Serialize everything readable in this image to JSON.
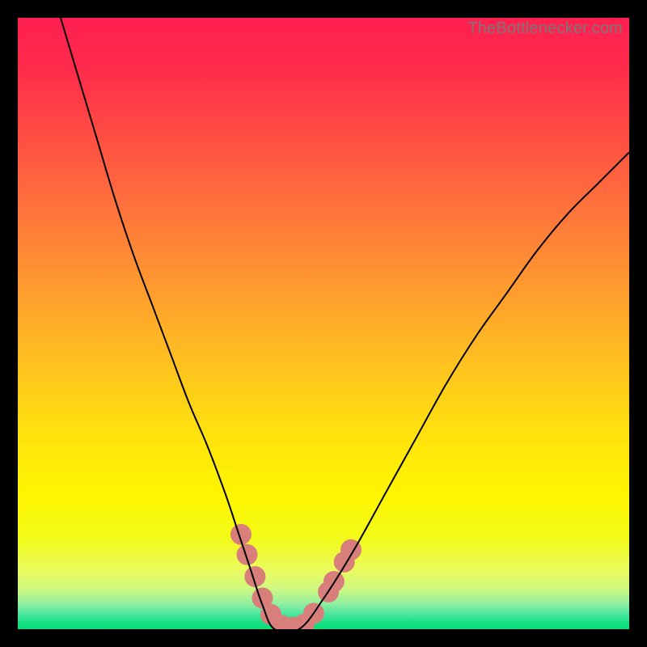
{
  "attribution": "TheBottlenecker.com",
  "chart_data": {
    "type": "line",
    "title": "",
    "xlabel": "",
    "ylabel": "",
    "xlim": [
      0,
      100
    ],
    "ylim": [
      0,
      100
    ],
    "series": [
      {
        "name": "bottleneck-curve",
        "x": [
          7,
          10,
          13,
          16,
          19,
          22,
          25,
          28,
          31,
          34,
          36,
          38,
          40,
          42,
          46,
          50,
          55,
          60,
          65,
          70,
          75,
          80,
          85,
          90,
          95,
          100
        ],
        "y": [
          100,
          90,
          80,
          70,
          61,
          53,
          45,
          37,
          30,
          22,
          16,
          10,
          4,
          0,
          0,
          5,
          13,
          22,
          31,
          40,
          48,
          55,
          62,
          68,
          73,
          78
        ]
      }
    ],
    "markers": [
      {
        "x": 36.5,
        "y": 15.5
      },
      {
        "x": 37.5,
        "y": 12.2
      },
      {
        "x": 38.8,
        "y": 8.6
      },
      {
        "x": 40.0,
        "y": 5.1
      },
      {
        "x": 41.4,
        "y": 2.4
      },
      {
        "x": 43.2,
        "y": 0.6
      },
      {
        "x": 45.0,
        "y": 0.3
      },
      {
        "x": 46.8,
        "y": 0.8
      },
      {
        "x": 48.4,
        "y": 2.6
      },
      {
        "x": 50.8,
        "y": 6.1
      },
      {
        "x": 51.7,
        "y": 7.8
      },
      {
        "x": 53.4,
        "y": 11.0
      },
      {
        "x": 54.5,
        "y": 13.0
      }
    ],
    "background": {
      "type": "vertical-gradient",
      "stops": [
        {
          "pos": 0,
          "color": "#ff1f4f"
        },
        {
          "pos": 0.08,
          "color": "#ff2b4c"
        },
        {
          "pos": 0.18,
          "color": "#ff4944"
        },
        {
          "pos": 0.3,
          "color": "#ff6f3d"
        },
        {
          "pos": 0.42,
          "color": "#ff9431"
        },
        {
          "pos": 0.55,
          "color": "#ffbd22"
        },
        {
          "pos": 0.68,
          "color": "#ffe20e"
        },
        {
          "pos": 0.78,
          "color": "#fff500"
        },
        {
          "pos": 0.85,
          "color": "#f3fb18"
        },
        {
          "pos": 0.905,
          "color": "#e9fb60"
        },
        {
          "pos": 0.935,
          "color": "#cdf882"
        },
        {
          "pos": 0.958,
          "color": "#93efa0"
        },
        {
          "pos": 0.975,
          "color": "#4ce6a0"
        },
        {
          "pos": 0.99,
          "color": "#16df82"
        },
        {
          "pos": 1.0,
          "color": "#09dd76"
        }
      ]
    },
    "marker_style": {
      "color": "#d87f7c",
      "radius_px": 13
    }
  }
}
